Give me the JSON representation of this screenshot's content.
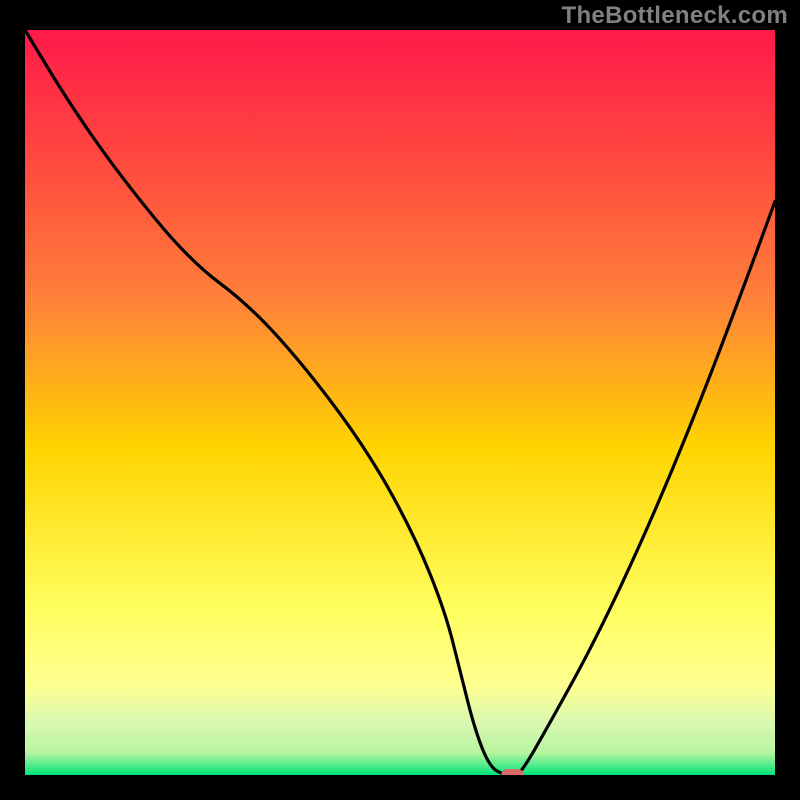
{
  "watermark": "TheBottleneck.com",
  "chart_data": {
    "type": "line",
    "title": "",
    "xlabel": "",
    "ylabel": "",
    "xlim": [
      0,
      100
    ],
    "ylim": [
      0,
      100
    ],
    "background_gradient": {
      "top": "#ff1a4a",
      "upper_mid": "#ff803a",
      "mid": "#ffd400",
      "lower_mid": "#ffff90",
      "near_bottom": "#b8f5a0",
      "bottom": "#00e37a"
    },
    "series": [
      {
        "name": "bottleneck-curve",
        "color": "#000000",
        "x": [
          0,
          6,
          13,
          22,
          30,
          38,
          46,
          52,
          56,
          58,
          60,
          62,
          64,
          65,
          66,
          70,
          76,
          83,
          90,
          96,
          100
        ],
        "y": [
          100,
          90,
          80,
          69,
          63,
          54,
          43,
          32,
          22,
          14,
          6,
          1,
          0,
          0,
          0,
          7,
          18,
          33,
          50,
          66,
          77
        ]
      }
    ],
    "marker": {
      "name": "optimal-point",
      "x": 65,
      "y": 0,
      "color": "#d86a6a",
      "width": 3.0,
      "height": 1.6
    }
  }
}
